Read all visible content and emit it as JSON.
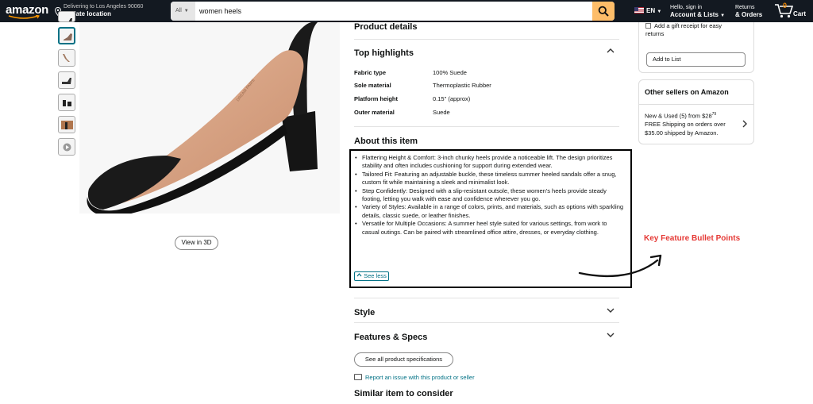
{
  "nav": {
    "logo": "amazon",
    "deliver_line1": "Delivering to Los Angeles 90060",
    "deliver_line2": "Update location",
    "search_dept": "All",
    "search_query": "women heels",
    "lang": "EN",
    "account_line1": "Hello, sign in",
    "account_line2": "Account & Lists",
    "orders_line1": "Returns",
    "orders_line2": "& Orders",
    "cart_count": "0",
    "cart_label": "Cart"
  },
  "gallery": {
    "view3d_label": "View in 3D",
    "thumb_count": 7
  },
  "product": {
    "product_details_heading": "Product details",
    "top_highlights_heading": "Top highlights",
    "specs": [
      {
        "key": "Fabric type",
        "value": "100% Suede"
      },
      {
        "key": "Sole material",
        "value": "Thermoplastic Rubber"
      },
      {
        "key": "Platform height",
        "value": "0.15\" (approx)"
      },
      {
        "key": "Outer material",
        "value": "Suede"
      }
    ],
    "about_heading": "About this item",
    "bullets": [
      "Flattering Height & Comfort: 3-inch chunky heels provide a noticeable lift. The design prioritizes stability and often includes cushioning for support during extended wear.",
      "Tailored Fit: Featuring an adjustable buckle, these timeless summer heeled sandals offer a snug, custom fit while maintaining a sleek and minimalist look.",
      "Step Confidently: Designed with a slip-resistant outsole, these women's heels provide steady footing, letting you walk with ease and confidence wherever you go.",
      "Variety of Styles: Available in a range of colors, prints, and materials, such as options with sparkling details, classic suede, or leather finishes.",
      "Versatile for Multiple Occasions: A summer heel style suited for various settings, from work to casual outings. Can be paired with streamlined office attire, dresses, or everyday clothing."
    ],
    "see_less": "See less",
    "style_heading": "Style",
    "features_heading": "Features & Specs",
    "see_all_specs": "See all product specifications",
    "report_link": "Report an issue with this product or seller",
    "similar_heading": "Similar item to consider"
  },
  "buybox": {
    "gift_receipt": "Add a gift receipt for easy returns",
    "add_to_list": "Add to List"
  },
  "sellers": {
    "title": "Other sellers on Amazon",
    "line1_prefix": "New & Used (5) from ",
    "price_dollars": "$28",
    "price_cents": "79",
    "line2": "FREE Shipping on orders over $35.00 shipped by Amazon."
  },
  "annotation": {
    "label": "Key Feature Bullet Points",
    "color": "#e53935"
  },
  "colors": {
    "nav_bg": "#131921",
    "search_button": "#febd69",
    "link": "#007185",
    "cart_count": "#f08804"
  }
}
